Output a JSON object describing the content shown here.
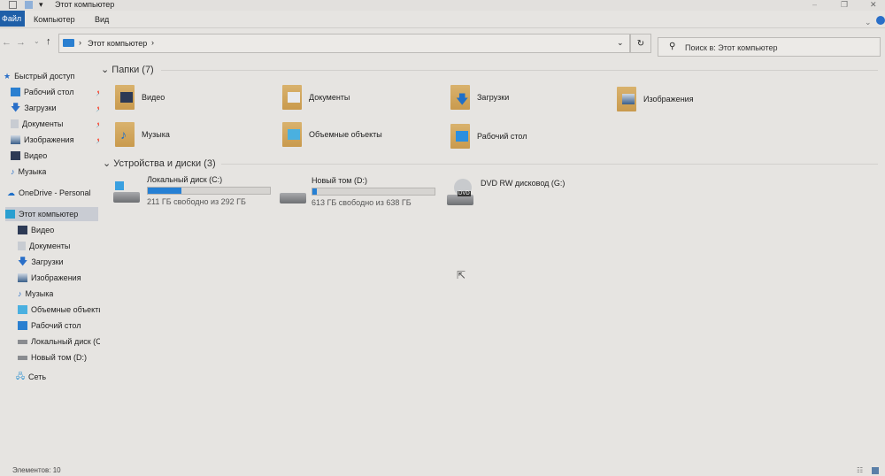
{
  "window": {
    "title": "Этот компьютер",
    "controls": [
      "minimize",
      "maximize",
      "close"
    ]
  },
  "ribbon": {
    "tabs": [
      "Файл",
      "Компьютер",
      "Вид"
    ]
  },
  "address": {
    "path": "Этот компьютер",
    "search_placeholder": "Поиск в: Этот компьютер"
  },
  "sidebar": {
    "quick_access": "Быстрый доступ",
    "quick_items": [
      {
        "label": "Рабочий стол",
        "pinned": true
      },
      {
        "label": "Загрузки",
        "pinned": true
      },
      {
        "label": "Документы",
        "pinned": true
      },
      {
        "label": "Изображения",
        "pinned": true
      },
      {
        "label": "Видео",
        "pinned": false
      },
      {
        "label": "Музыка",
        "pinned": false
      }
    ],
    "onedrive": "OneDrive - Personal",
    "this_pc": "Этот компьютер",
    "pc_items": [
      "Видео",
      "Документы",
      "Загрузки",
      "Изображения",
      "Музыка",
      "Объемные объекты",
      "Рабочий стол",
      "Локальный диск (C:)",
      "Новый том (D:)"
    ],
    "network": "Сеть"
  },
  "folders": {
    "header": "Папки (7)",
    "items": [
      "Видео",
      "Документы",
      "Загрузки",
      "Изображения",
      "Музыка",
      "Объемные объекты",
      "Рабочий стол"
    ]
  },
  "drives": {
    "header": "Устройства и диски (3)",
    "items": [
      {
        "name": "Локальный диск (C:)",
        "info": "211 ГБ свободно из 292 ГБ",
        "used_fraction": 0.277
      },
      {
        "name": "Новый том (D:)",
        "info": "613 ГБ свободно из 638 ГБ",
        "used_fraction": 0.039
      },
      {
        "name": "DVD RW дисковод (G:)",
        "dvd_label": "DVD"
      }
    ]
  },
  "status": {
    "count": "Элементов: 10"
  }
}
